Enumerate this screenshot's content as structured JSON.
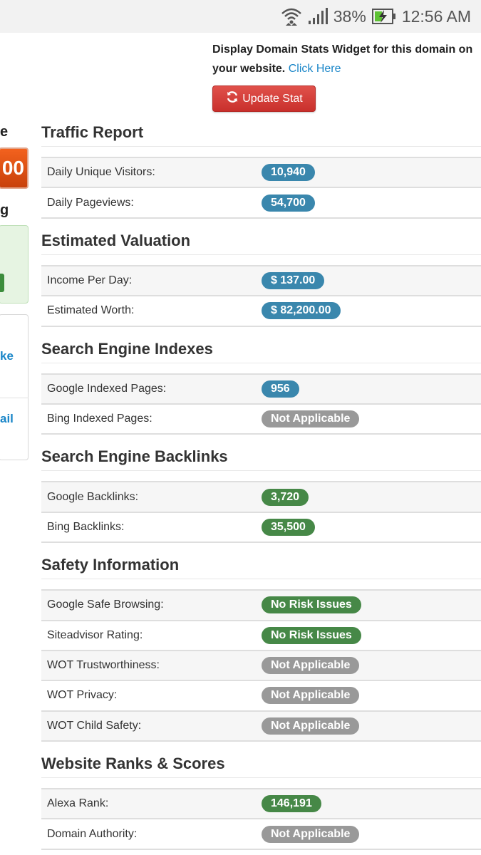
{
  "status_bar": {
    "battery": "38%",
    "time": "12:56 AM"
  },
  "promo": {
    "text": "Display Domain Stats Widget for this domain on your website.",
    "link": "Click Here"
  },
  "update_button": {
    "label": "Update Stat"
  },
  "left_column": {
    "frag_e": "e",
    "frag_box": "00",
    "frag_g": "g",
    "frag_ke": "ke",
    "frag_ail": "ail"
  },
  "colors": {
    "blue": "#3a87ad",
    "green": "#468847",
    "gray": "#999999",
    "red": "#d9534f",
    "link": "#1a86c8"
  },
  "sections": [
    {
      "title": "Traffic Report",
      "rows": [
        {
          "label": "Daily Unique Visitors:",
          "value": "10,940",
          "color": "blue"
        },
        {
          "label": "Daily Pageviews:",
          "value": "54,700",
          "color": "blue"
        }
      ]
    },
    {
      "title": "Estimated Valuation",
      "rows": [
        {
          "label": "Income Per Day:",
          "value": "$ 137.00",
          "color": "blue"
        },
        {
          "label": "Estimated Worth:",
          "value": "$ 82,200.00",
          "color": "blue"
        }
      ]
    },
    {
      "title": "Search Engine Indexes",
      "rows": [
        {
          "label": "Google Indexed Pages:",
          "value": "956",
          "color": "blue"
        },
        {
          "label": "Bing Indexed Pages:",
          "value": "Not Applicable",
          "color": "gray"
        }
      ]
    },
    {
      "title": "Search Engine Backlinks",
      "rows": [
        {
          "label": "Google Backlinks:",
          "value": "3,720",
          "color": "green"
        },
        {
          "label": "Bing Backlinks:",
          "value": "35,500",
          "color": "green"
        }
      ]
    },
    {
      "title": "Safety Information",
      "rows": [
        {
          "label": "Google Safe Browsing:",
          "value": "No Risk Issues",
          "color": "green"
        },
        {
          "label": "Siteadvisor Rating:",
          "value": "No Risk Issues",
          "color": "green"
        },
        {
          "label": "WOT Trustworthiness:",
          "value": "Not Applicable",
          "color": "gray"
        },
        {
          "label": "WOT Privacy:",
          "value": "Not Applicable",
          "color": "gray"
        },
        {
          "label": "WOT Child Safety:",
          "value": "Not Applicable",
          "color": "gray"
        }
      ]
    },
    {
      "title": "Website Ranks & Scores",
      "rows": [
        {
          "label": "Alexa Rank:",
          "value": "146,191",
          "color": "green"
        },
        {
          "label": "Domain Authority:",
          "value": "Not Applicable",
          "color": "gray"
        }
      ]
    }
  ]
}
